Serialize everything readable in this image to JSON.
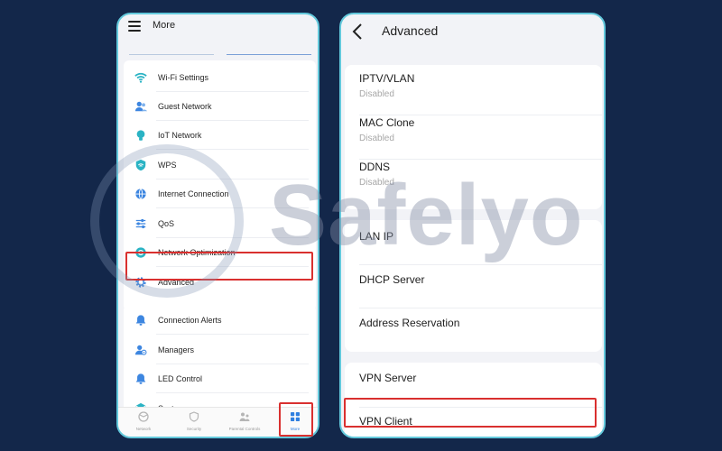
{
  "left_phone": {
    "header_title": "More",
    "menu_items": [
      {
        "label": "Wi-Fi Settings",
        "icon": "wifi-icon",
        "color": "#2ab3c4"
      },
      {
        "label": "Guest Network",
        "icon": "guest-users-icon",
        "color": "#3d86e0"
      },
      {
        "label": "IoT Network",
        "icon": "bulb-icon",
        "color": "#2ab3c4"
      },
      {
        "label": "WPS",
        "icon": "wps-shield-icon",
        "color": "#2ab3c4"
      },
      {
        "label": "Internet Connection",
        "icon": "globe-icon",
        "color": "#3d86e0"
      },
      {
        "label": "QoS",
        "icon": "sliders-icon",
        "color": "#3d86e0"
      },
      {
        "label": "Network Optimization",
        "icon": "optimize-icon",
        "color": "#2ab3c4"
      },
      {
        "label": "Advanced",
        "icon": "gear-icon",
        "color": "#3d86e0"
      },
      {
        "label": "Connection Alerts",
        "icon": "bell-icon",
        "color": "#3d86e0"
      },
      {
        "label": "Managers",
        "icon": "manager-icon",
        "color": "#3d86e0"
      },
      {
        "label": "LED Control",
        "icon": "led-bell-icon",
        "color": "#3d86e0"
      },
      {
        "label": "System",
        "icon": "cube-icon",
        "color": "#2ab3c4"
      }
    ],
    "tabs": [
      {
        "label": "Network",
        "icon": "network-tab-icon"
      },
      {
        "label": "Security",
        "icon": "security-tab-icon"
      },
      {
        "label": "Parental Controls",
        "icon": "parental-tab-icon"
      },
      {
        "label": "More",
        "icon": "more-grid-icon",
        "active": true
      }
    ]
  },
  "right_phone": {
    "header_title": "Advanced",
    "groups": [
      [
        {
          "label": "IPTV/VLAN",
          "status": "Disabled"
        },
        {
          "label": "MAC Clone",
          "status": "Disabled"
        },
        {
          "label": "DDNS",
          "status": "Disabled"
        }
      ],
      [
        {
          "label": "LAN IP"
        },
        {
          "label": "DHCP Server"
        },
        {
          "label": "Address Reservation"
        }
      ],
      [
        {
          "label": "VPN Server"
        },
        {
          "label": "VPN Client"
        }
      ]
    ]
  },
  "watermark": {
    "text": "Safelyo"
  },
  "colors": {
    "background": "#13274a",
    "phone_border": "#63c9dc",
    "highlight": "#d9302f",
    "accent": "#2f7fe0"
  }
}
